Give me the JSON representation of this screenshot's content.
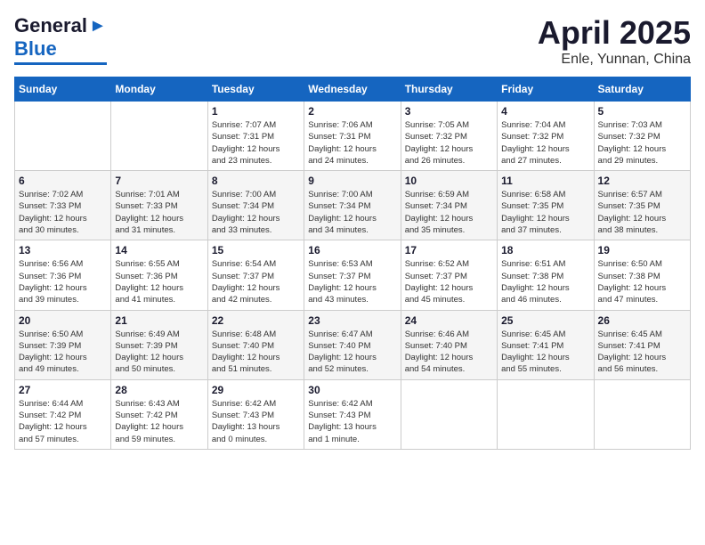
{
  "header": {
    "logo_general": "General",
    "logo_blue": "Blue",
    "title": "April 2025",
    "location": "Enle, Yunnan, China"
  },
  "calendar": {
    "weekdays": [
      "Sunday",
      "Monday",
      "Tuesday",
      "Wednesday",
      "Thursday",
      "Friday",
      "Saturday"
    ],
    "rows": [
      [
        {
          "day": "",
          "info": ""
        },
        {
          "day": "",
          "info": ""
        },
        {
          "day": "1",
          "info": "Sunrise: 7:07 AM\nSunset: 7:31 PM\nDaylight: 12 hours\nand 23 minutes."
        },
        {
          "day": "2",
          "info": "Sunrise: 7:06 AM\nSunset: 7:31 PM\nDaylight: 12 hours\nand 24 minutes."
        },
        {
          "day": "3",
          "info": "Sunrise: 7:05 AM\nSunset: 7:32 PM\nDaylight: 12 hours\nand 26 minutes."
        },
        {
          "day": "4",
          "info": "Sunrise: 7:04 AM\nSunset: 7:32 PM\nDaylight: 12 hours\nand 27 minutes."
        },
        {
          "day": "5",
          "info": "Sunrise: 7:03 AM\nSunset: 7:32 PM\nDaylight: 12 hours\nand 29 minutes."
        }
      ],
      [
        {
          "day": "6",
          "info": "Sunrise: 7:02 AM\nSunset: 7:33 PM\nDaylight: 12 hours\nand 30 minutes."
        },
        {
          "day": "7",
          "info": "Sunrise: 7:01 AM\nSunset: 7:33 PM\nDaylight: 12 hours\nand 31 minutes."
        },
        {
          "day": "8",
          "info": "Sunrise: 7:00 AM\nSunset: 7:34 PM\nDaylight: 12 hours\nand 33 minutes."
        },
        {
          "day": "9",
          "info": "Sunrise: 7:00 AM\nSunset: 7:34 PM\nDaylight: 12 hours\nand 34 minutes."
        },
        {
          "day": "10",
          "info": "Sunrise: 6:59 AM\nSunset: 7:34 PM\nDaylight: 12 hours\nand 35 minutes."
        },
        {
          "day": "11",
          "info": "Sunrise: 6:58 AM\nSunset: 7:35 PM\nDaylight: 12 hours\nand 37 minutes."
        },
        {
          "day": "12",
          "info": "Sunrise: 6:57 AM\nSunset: 7:35 PM\nDaylight: 12 hours\nand 38 minutes."
        }
      ],
      [
        {
          "day": "13",
          "info": "Sunrise: 6:56 AM\nSunset: 7:36 PM\nDaylight: 12 hours\nand 39 minutes."
        },
        {
          "day": "14",
          "info": "Sunrise: 6:55 AM\nSunset: 7:36 PM\nDaylight: 12 hours\nand 41 minutes."
        },
        {
          "day": "15",
          "info": "Sunrise: 6:54 AM\nSunset: 7:37 PM\nDaylight: 12 hours\nand 42 minutes."
        },
        {
          "day": "16",
          "info": "Sunrise: 6:53 AM\nSunset: 7:37 PM\nDaylight: 12 hours\nand 43 minutes."
        },
        {
          "day": "17",
          "info": "Sunrise: 6:52 AM\nSunset: 7:37 PM\nDaylight: 12 hours\nand 45 minutes."
        },
        {
          "day": "18",
          "info": "Sunrise: 6:51 AM\nSunset: 7:38 PM\nDaylight: 12 hours\nand 46 minutes."
        },
        {
          "day": "19",
          "info": "Sunrise: 6:50 AM\nSunset: 7:38 PM\nDaylight: 12 hours\nand 47 minutes."
        }
      ],
      [
        {
          "day": "20",
          "info": "Sunrise: 6:50 AM\nSunset: 7:39 PM\nDaylight: 12 hours\nand 49 minutes."
        },
        {
          "day": "21",
          "info": "Sunrise: 6:49 AM\nSunset: 7:39 PM\nDaylight: 12 hours\nand 50 minutes."
        },
        {
          "day": "22",
          "info": "Sunrise: 6:48 AM\nSunset: 7:40 PM\nDaylight: 12 hours\nand 51 minutes."
        },
        {
          "day": "23",
          "info": "Sunrise: 6:47 AM\nSunset: 7:40 PM\nDaylight: 12 hours\nand 52 minutes."
        },
        {
          "day": "24",
          "info": "Sunrise: 6:46 AM\nSunset: 7:40 PM\nDaylight: 12 hours\nand 54 minutes."
        },
        {
          "day": "25",
          "info": "Sunrise: 6:45 AM\nSunset: 7:41 PM\nDaylight: 12 hours\nand 55 minutes."
        },
        {
          "day": "26",
          "info": "Sunrise: 6:45 AM\nSunset: 7:41 PM\nDaylight: 12 hours\nand 56 minutes."
        }
      ],
      [
        {
          "day": "27",
          "info": "Sunrise: 6:44 AM\nSunset: 7:42 PM\nDaylight: 12 hours\nand 57 minutes."
        },
        {
          "day": "28",
          "info": "Sunrise: 6:43 AM\nSunset: 7:42 PM\nDaylight: 12 hours\nand 59 minutes."
        },
        {
          "day": "29",
          "info": "Sunrise: 6:42 AM\nSunset: 7:43 PM\nDaylight: 13 hours\nand 0 minutes."
        },
        {
          "day": "30",
          "info": "Sunrise: 6:42 AM\nSunset: 7:43 PM\nDaylight: 13 hours\nand 1 minute."
        },
        {
          "day": "",
          "info": ""
        },
        {
          "day": "",
          "info": ""
        },
        {
          "day": "",
          "info": ""
        }
      ]
    ]
  }
}
